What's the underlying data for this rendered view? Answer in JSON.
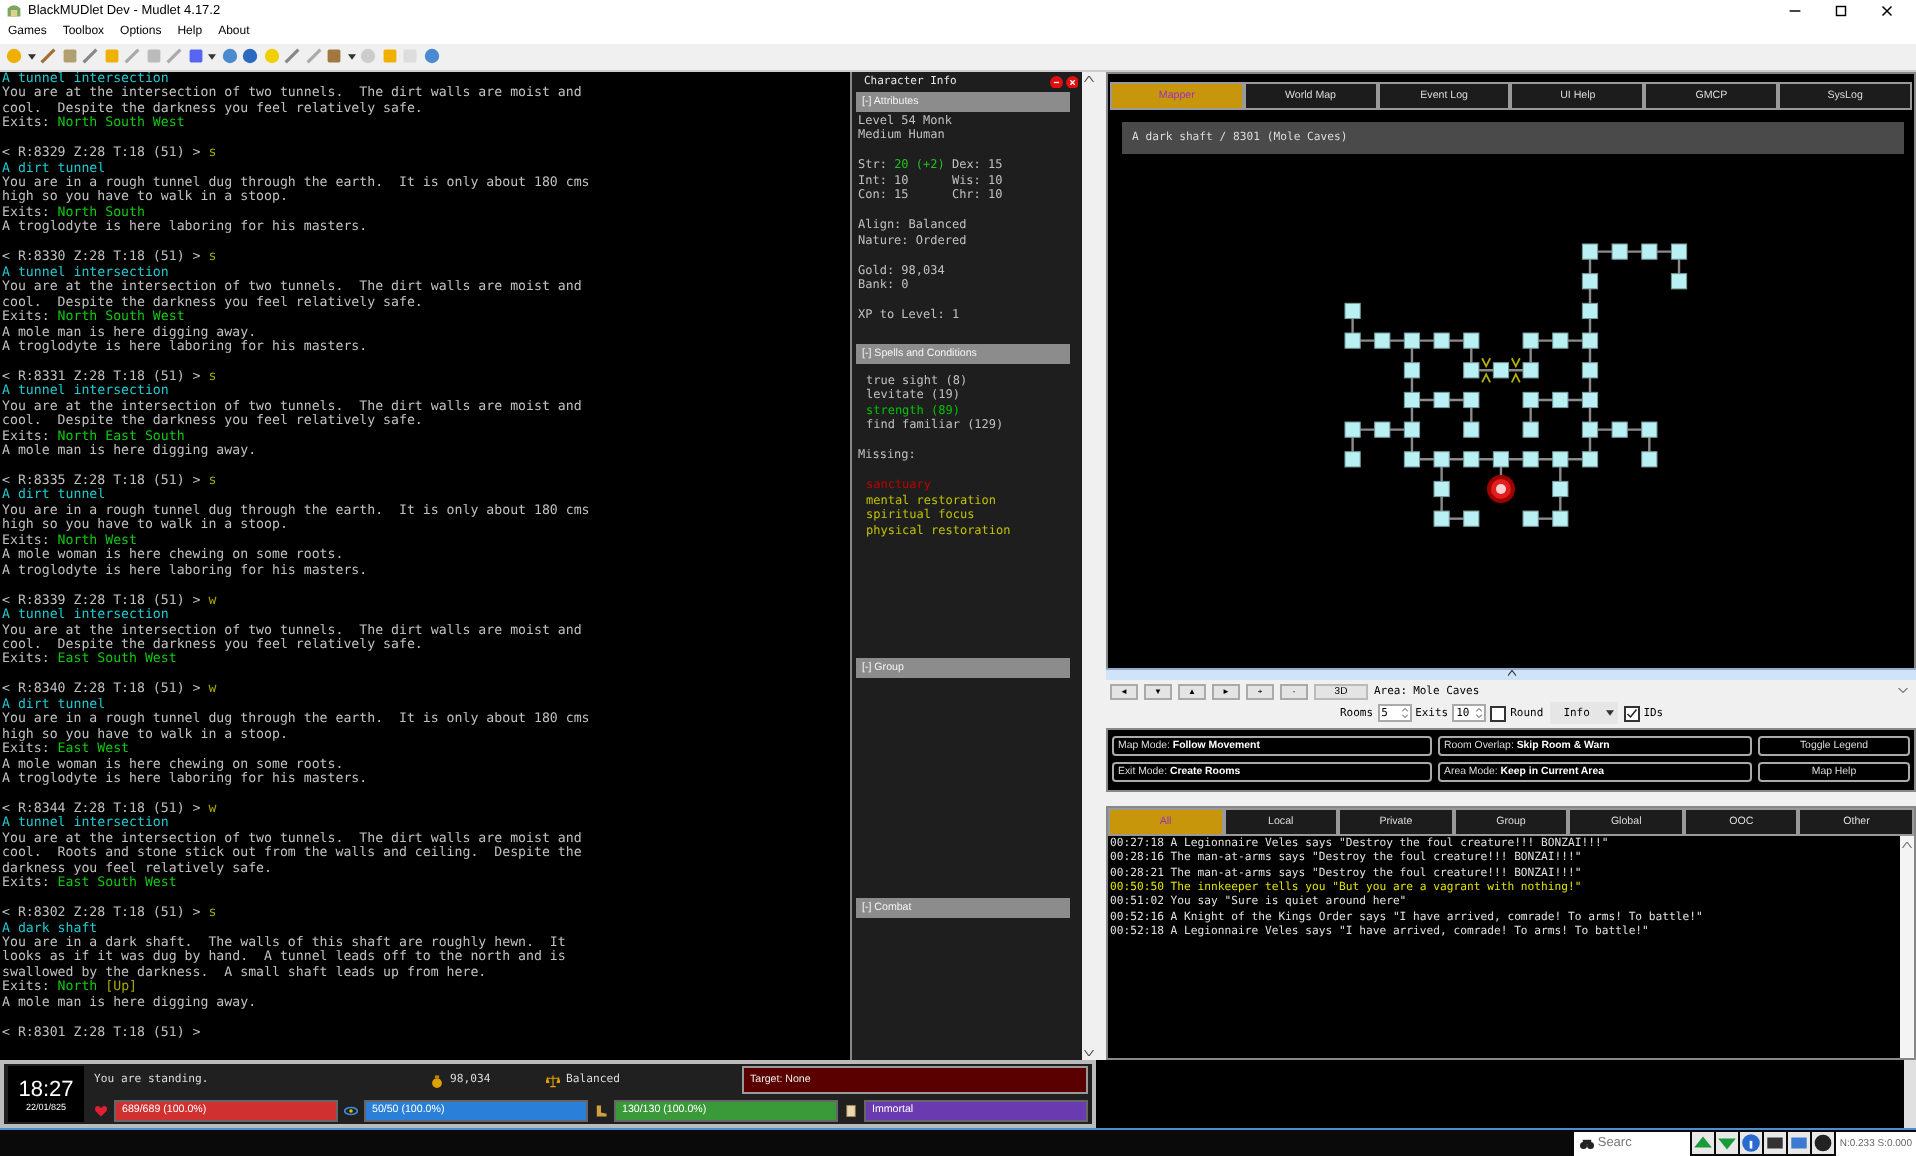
{
  "window": {
    "title": "BlackMUDlet Dev - Mudlet 4.17.2"
  },
  "menu": [
    "Games",
    "Toolbox",
    "Options",
    "Help",
    "About"
  ],
  "terminal": [
    {
      "kind": "text",
      "parts": [
        {
          "kind": "room",
          "text": "A tunnel intersection"
        }
      ]
    },
    {
      "kind": "text",
      "parts": [
        {
          "kind": "plain",
          "text": "You are at the intersection of two tunnels.  The dirt walls are moist and"
        }
      ]
    },
    {
      "kind": "text",
      "parts": [
        {
          "kind": "plain",
          "text": "cool.  Despite the darkness you feel relatively safe."
        }
      ]
    },
    {
      "kind": "text",
      "parts": [
        {
          "kind": "plain",
          "text": "Exits: "
        },
        {
          "kind": "exit",
          "text": "North South West"
        }
      ]
    },
    {
      "kind": "blank"
    },
    {
      "kind": "text",
      "parts": [
        {
          "kind": "prompt",
          "text": "< R:8329 Z:28 T:18 (51) > "
        },
        {
          "kind": "command",
          "text": "s"
        }
      ]
    },
    {
      "kind": "text",
      "parts": [
        {
          "kind": "room",
          "text": "A dirt tunnel"
        }
      ]
    },
    {
      "kind": "text",
      "parts": [
        {
          "kind": "plain",
          "text": "You are in a rough tunnel dug through the earth.  It is only about 180 cms"
        }
      ]
    },
    {
      "kind": "text",
      "parts": [
        {
          "kind": "plain",
          "text": "high so you have to walk in a stoop."
        }
      ]
    },
    {
      "kind": "text",
      "parts": [
        {
          "kind": "plain",
          "text": "Exits: "
        },
        {
          "kind": "exit",
          "text": "North South"
        }
      ]
    },
    {
      "kind": "text",
      "parts": [
        {
          "kind": "plain",
          "text": "A troglodyte is here laboring for his masters."
        }
      ]
    },
    {
      "kind": "blank"
    },
    {
      "kind": "text",
      "parts": [
        {
          "kind": "prompt",
          "text": "< R:8330 Z:28 T:18 (51) > "
        },
        {
          "kind": "command",
          "text": "s"
        }
      ]
    },
    {
      "kind": "text",
      "parts": [
        {
          "kind": "room",
          "text": "A tunnel intersection"
        }
      ]
    },
    {
      "kind": "text",
      "parts": [
        {
          "kind": "plain",
          "text": "You are at the intersection of two tunnels.  The dirt walls are moist and"
        }
      ]
    },
    {
      "kind": "text",
      "parts": [
        {
          "kind": "plain",
          "text": "cool.  Despite the darkness you feel relatively safe."
        }
      ]
    },
    {
      "kind": "text",
      "parts": [
        {
          "kind": "plain",
          "text": "Exits: "
        },
        {
          "kind": "exit",
          "text": "North South West"
        }
      ]
    },
    {
      "kind": "text",
      "parts": [
        {
          "kind": "plain",
          "text": "A mole man is here digging away."
        }
      ]
    },
    {
      "kind": "text",
      "parts": [
        {
          "kind": "plain",
          "text": "A troglodyte is here laboring for his masters."
        }
      ]
    },
    {
      "kind": "blank"
    },
    {
      "kind": "text",
      "parts": [
        {
          "kind": "prompt",
          "text": "< R:8331 Z:28 T:18 (51) > "
        },
        {
          "kind": "command",
          "text": "s"
        }
      ]
    },
    {
      "kind": "text",
      "parts": [
        {
          "kind": "room",
          "text": "A tunnel intersection"
        }
      ]
    },
    {
      "kind": "text",
      "parts": [
        {
          "kind": "plain",
          "text": "You are at the intersection of two tunnels.  The dirt walls are moist and"
        }
      ]
    },
    {
      "kind": "text",
      "parts": [
        {
          "kind": "plain",
          "text": "cool.  Despite the darkness you feel relatively safe."
        }
      ]
    },
    {
      "kind": "text",
      "parts": [
        {
          "kind": "plain",
          "text": "Exits: "
        },
        {
          "kind": "exit",
          "text": "North East South"
        }
      ]
    },
    {
      "kind": "text",
      "parts": [
        {
          "kind": "plain",
          "text": "A mole man is here digging away."
        }
      ]
    },
    {
      "kind": "blank"
    },
    {
      "kind": "text",
      "parts": [
        {
          "kind": "prompt",
          "text": "< R:8335 Z:28 T:18 (51) > "
        },
        {
          "kind": "command",
          "text": "s"
        }
      ]
    },
    {
      "kind": "text",
      "parts": [
        {
          "kind": "room",
          "text": "A dirt tunnel"
        }
      ]
    },
    {
      "kind": "text",
      "parts": [
        {
          "kind": "plain",
          "text": "You are in a rough tunnel dug through the earth.  It is only about 180 cms"
        }
      ]
    },
    {
      "kind": "text",
      "parts": [
        {
          "kind": "plain",
          "text": "high so you have to walk in a stoop."
        }
      ]
    },
    {
      "kind": "text",
      "parts": [
        {
          "kind": "plain",
          "text": "Exits: "
        },
        {
          "kind": "exit",
          "text": "North West"
        }
      ]
    },
    {
      "kind": "text",
      "parts": [
        {
          "kind": "plain",
          "text": "A mole woman is here chewing on some roots."
        }
      ]
    },
    {
      "kind": "text",
      "parts": [
        {
          "kind": "plain",
          "text": "A troglodyte is here laboring for his masters."
        }
      ]
    },
    {
      "kind": "blank"
    },
    {
      "kind": "text",
      "parts": [
        {
          "kind": "prompt",
          "text": "< R:8339 Z:28 T:18 (51) > "
        },
        {
          "kind": "command",
          "text": "w"
        }
      ]
    },
    {
      "kind": "text",
      "parts": [
        {
          "kind": "room",
          "text": "A tunnel intersection"
        }
      ]
    },
    {
      "kind": "text",
      "parts": [
        {
          "kind": "plain",
          "text": "You are at the intersection of two tunnels.  The dirt walls are moist and"
        }
      ]
    },
    {
      "kind": "text",
      "parts": [
        {
          "kind": "plain",
          "text": "cool.  Despite the darkness you feel relatively safe."
        }
      ]
    },
    {
      "kind": "text",
      "parts": [
        {
          "kind": "plain",
          "text": "Exits: "
        },
        {
          "kind": "exit",
          "text": "East South West"
        }
      ]
    },
    {
      "kind": "blank"
    },
    {
      "kind": "text",
      "parts": [
        {
          "kind": "prompt",
          "text": "< R:8340 Z:28 T:18 (51) > "
        },
        {
          "kind": "command",
          "text": "w"
        }
      ]
    },
    {
      "kind": "text",
      "parts": [
        {
          "kind": "room",
          "text": "A dirt tunnel"
        }
      ]
    },
    {
      "kind": "text",
      "parts": [
        {
          "kind": "plain",
          "text": "You are in a rough tunnel dug through the earth.  It is only about 180 cms"
        }
      ]
    },
    {
      "kind": "text",
      "parts": [
        {
          "kind": "plain",
          "text": "high so you have to walk in a stoop."
        }
      ]
    },
    {
      "kind": "text",
      "parts": [
        {
          "kind": "plain",
          "text": "Exits: "
        },
        {
          "kind": "exit",
          "text": "East West"
        }
      ]
    },
    {
      "kind": "text",
      "parts": [
        {
          "kind": "plain",
          "text": "A mole woman is here chewing on some roots."
        }
      ]
    },
    {
      "kind": "text",
      "parts": [
        {
          "kind": "plain",
          "text": "A troglodyte is here laboring for his masters."
        }
      ]
    },
    {
      "kind": "blank"
    },
    {
      "kind": "text",
      "parts": [
        {
          "kind": "prompt",
          "text": "< R:8344 Z:28 T:18 (51) > "
        },
        {
          "kind": "command",
          "text": "w"
        }
      ]
    },
    {
      "kind": "text",
      "parts": [
        {
          "kind": "room",
          "text": "A tunnel intersection"
        }
      ]
    },
    {
      "kind": "text",
      "parts": [
        {
          "kind": "plain",
          "text": "You are at the intersection of two tunnels.  The dirt walls are moist and"
        }
      ]
    },
    {
      "kind": "text",
      "parts": [
        {
          "kind": "plain",
          "text": "cool.  Roots and stone stick out from the walls and ceiling.  Despite the"
        }
      ]
    },
    {
      "kind": "text",
      "parts": [
        {
          "kind": "plain",
          "text": "darkness you feel relatively safe."
        }
      ]
    },
    {
      "kind": "text",
      "parts": [
        {
          "kind": "plain",
          "text": "Exits: "
        },
        {
          "kind": "exit",
          "text": "East South West"
        }
      ]
    },
    {
      "kind": "blank"
    },
    {
      "kind": "text",
      "parts": [
        {
          "kind": "prompt",
          "text": "< R:8302 Z:28 T:18 (51) > "
        },
        {
          "kind": "command",
          "text": "s"
        }
      ]
    },
    {
      "kind": "text",
      "parts": [
        {
          "kind": "room",
          "text": "A dark shaft"
        }
      ]
    },
    {
      "kind": "text",
      "parts": [
        {
          "kind": "plain",
          "text": "You are in a dark shaft.  The walls of this shaft are roughly hewn.  It"
        }
      ]
    },
    {
      "kind": "text",
      "parts": [
        {
          "kind": "plain",
          "text": "looks as if it was dug by hand.  A tunnel leads off to the north and is"
        }
      ]
    },
    {
      "kind": "text",
      "parts": [
        {
          "kind": "plain",
          "text": "swallowed by the darkness.  A small shaft leads up from here."
        }
      ]
    },
    {
      "kind": "text",
      "parts": [
        {
          "kind": "plain",
          "text": "Exits: "
        },
        {
          "kind": "exit",
          "text": "North "
        },
        {
          "kind": "command",
          "text": "[Up]"
        }
      ]
    },
    {
      "kind": "text",
      "parts": [
        {
          "kind": "plain",
          "text": "A mole man is here digging away."
        }
      ]
    },
    {
      "kind": "blank"
    },
    {
      "kind": "text",
      "parts": [
        {
          "kind": "prompt",
          "text": "< R:8301 Z:28 T:18 (51) >"
        }
      ]
    }
  ],
  "character_info": {
    "title": "Character Info",
    "sections": [
      {
        "kind": "attributes",
        "header": "[-] Attributes",
        "lines": [
          {
            "kind": "text",
            "parts": [
              {
                "kind": "plain",
                "text": "Level 54 Monk"
              }
            ]
          },
          {
            "kind": "text",
            "parts": [
              {
                "kind": "plain",
                "text": "Medium Human"
              }
            ]
          },
          {
            "kind": "blank"
          },
          {
            "kind": "text",
            "parts": [
              {
                "kind": "plain",
                "text": "Str: "
              },
              {
                "kind": "boost",
                "text": "20 (+2)"
              },
              {
                "kind": "plain",
                "text": " Dex: 15"
              }
            ]
          },
          {
            "kind": "text",
            "parts": [
              {
                "kind": "plain",
                "text": "Int: 10      Wis: 10"
              }
            ]
          },
          {
            "kind": "text",
            "parts": [
              {
                "kind": "plain",
                "text": "Con: 15      Chr: 10"
              }
            ]
          },
          {
            "kind": "blank"
          },
          {
            "kind": "text",
            "parts": [
              {
                "kind": "plain",
                "text": "Align: Balanced"
              }
            ]
          },
          {
            "kind": "text",
            "parts": [
              {
                "kind": "plain",
                "text": "Nature: Ordered"
              }
            ]
          },
          {
            "kind": "blank"
          },
          {
            "kind": "text",
            "parts": [
              {
                "kind": "plain",
                "text": "Gold: 98,034"
              }
            ]
          },
          {
            "kind": "text",
            "parts": [
              {
                "kind": "plain",
                "text": "Bank: 0"
              }
            ]
          },
          {
            "kind": "blank"
          },
          {
            "kind": "text",
            "parts": [
              {
                "kind": "plain",
                "text": "XP to Level: 1"
              }
            ]
          }
        ]
      },
      {
        "kind": "spells",
        "header": "[-] Spells and Conditions",
        "active": [
          {
            "text": "true sight (8)",
            "color": "#c0c0c0"
          },
          {
            "text": "levitate (19)",
            "color": "#c0c0c0"
          },
          {
            "text": "strength (89)",
            "color": "#00c000"
          },
          {
            "text": "find familiar (129)",
            "color": "#c0c0c0"
          }
        ],
        "missing_label": "Missing:",
        "missing": [
          {
            "text": "sanctuary",
            "color": "#c00000"
          },
          {
            "text": "mental restoration",
            "color": "#c0c000"
          },
          {
            "text": "spiritual focus",
            "color": "#c0c000"
          },
          {
            "text": "physical restoration",
            "color": "#c0c000"
          }
        ]
      },
      {
        "kind": "group",
        "header": "[-] Group"
      },
      {
        "kind": "combat",
        "header": "[-] Combat"
      }
    ]
  },
  "mapper": {
    "tabs": [
      {
        "label": "Mapper",
        "selected": true
      },
      {
        "label": "World Map",
        "selected": false
      },
      {
        "label": "Event Log",
        "selected": false
      },
      {
        "label": "UI Help",
        "selected": false
      },
      {
        "label": "GMCP",
        "selected": false
      },
      {
        "label": "SysLog",
        "selected": false
      }
    ],
    "room_title": "A dark shaft / 8301 (Mole Caves)",
    "controls": {
      "nav_buttons": [
        "◄",
        "▼",
        "▲",
        "►",
        "+",
        "-"
      ],
      "view_button": "3D",
      "area_label": "Area:",
      "area_value": "Mole Caves",
      "rooms_label": "Rooms",
      "rooms_value": "5",
      "exits_label": "Exits",
      "exits_value": "10",
      "round": {
        "label": "Round",
        "checked": false
      },
      "info_dropdown": "Info",
      "ids": {
        "label": "IDs",
        "checked": true
      }
    },
    "mode_buttons": [
      "Map Mode: **Follow Movement**",
      "Room Overlap: **Skip Room & Warn**",
      "Toggle Legend",
      "Exit Mode: **Create Rooms**",
      "Area Mode: **Keep in Current Area**",
      "Map Help"
    ]
  },
  "chat": {
    "tabs": [
      {
        "label": "All",
        "selected": true
      },
      {
        "label": "Local",
        "selected": false
      },
      {
        "label": "Private",
        "selected": false
      },
      {
        "label": "Group",
        "selected": false
      },
      {
        "label": "Global",
        "selected": false
      },
      {
        "label": "OOC",
        "selected": false
      },
      {
        "label": "Other",
        "selected": false
      }
    ],
    "messages": [
      {
        "kind": "say",
        "text": "00:27:18 A Legionnaire Veles says \"Destroy the foul creature!!! BONZAI!!!\""
      },
      {
        "kind": "say",
        "text": "00:28:16 The man-at-arms says \"Destroy the foul creature!!! BONZAI!!!\""
      },
      {
        "kind": "say",
        "text": "00:28:21 The man-at-arms says \"Destroy the foul creature!!! BONZAI!!!\""
      },
      {
        "kind": "tell",
        "text": "00:50:50 The innkeeper tells you \"But you are a vagrant with nothing!\""
      },
      {
        "kind": "say",
        "text": "00:51:02 You say \"Sure is quiet around here\""
      },
      {
        "kind": "say",
        "text": "00:52:16 A Knight of the Kings Order says \"I have arrived, comrade! To arms! To battle!\""
      },
      {
        "kind": "say",
        "text": "00:52:18 A Legionnaire Veles says \"I have arrived, comrade! To arms! To battle!\""
      }
    ]
  },
  "status": {
    "clock": "18:27",
    "date": "22/01/825",
    "position": "You are standing.",
    "gold": "98,034",
    "alignment": "Balanced",
    "target": "Target: None",
    "bars": [
      {
        "kind": "health",
        "label": "689/689 (100.0%)",
        "level": 1
      },
      {
        "kind": "mana",
        "label": "50/50 (100.0%)",
        "level": 1
      },
      {
        "kind": "moves",
        "label": "130/130 (100.0%)",
        "level": 1
      },
      {
        "kind": "rank",
        "label": "Immortal",
        "level": 1
      }
    ]
  },
  "taskbar": {
    "search_placeholder": "Searc",
    "stats": "N:0.233 S:0.000"
  }
}
